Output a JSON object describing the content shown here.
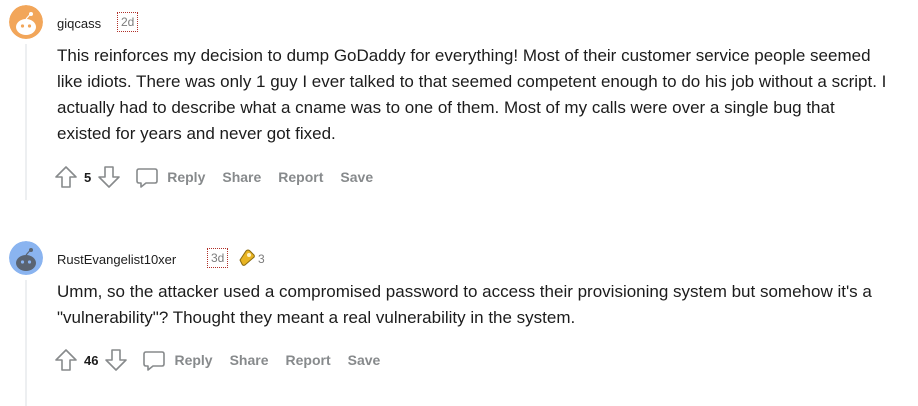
{
  "comments": [
    {
      "username": "giqcass",
      "timestamp": "2d",
      "body": "This reinforces my decision to dump GoDaddy for everything! Most of their customer service people seemed like idiots. There was only 1 guy I ever talked to that seemed competent enough to do his job without a script. I actually had to describe what a cname was to one of them. Most of my calls were over a single bug that existed for years and never got fixed.",
      "score": "5",
      "reply_label": "Reply",
      "share_label": "Share",
      "report_label": "Report",
      "save_label": "Save",
      "avatar_color": "#f2a65a"
    },
    {
      "username": "RustEvangelist10xer",
      "timestamp": "3d",
      "award_count": "3",
      "body": "Umm, so the attacker used a compromised password to access their provisioning system but somehow it's a \"vulnerability\"? Thought they meant a real vulnerability in the system.",
      "score": "46",
      "reply_label": "Reply",
      "share_label": "Share",
      "report_label": "Report",
      "save_label": "Save",
      "avatar_color": "#8ab4f0"
    }
  ],
  "colors": {
    "text": "#1c1c1c",
    "meta": "#7c7c7c",
    "action": "#878a8c",
    "thread_line": "#edeff1",
    "award": "#e8b422"
  }
}
